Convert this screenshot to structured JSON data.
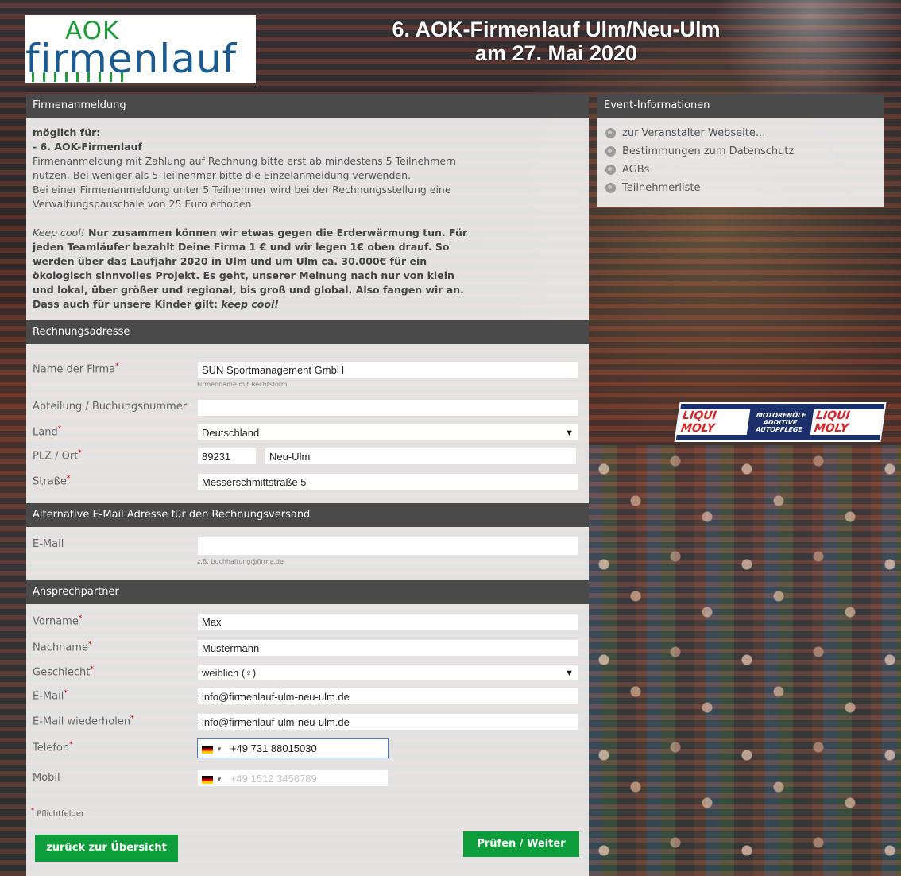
{
  "header": {
    "logo_aok": "AOK",
    "logo_firmenlauf": "firmenlauf",
    "title_line1": "6. AOK-Firmenlauf Ulm/Neu-Ulm",
    "title_line2": "am 27. Mai 2020"
  },
  "background": {
    "banner_left": "LIQUI MOLY",
    "banner_mid": "MOTORENÖLE ADDITIVE AUTOPFLEGE",
    "banner_right": "LIQUI MOLY"
  },
  "firmenanmeldung": {
    "heading": "Firmenanmeldung",
    "possible_for": "möglich für:",
    "event": "- 6. AOK-Firmenlauf",
    "line1": "Firmenanmeldung mit Zahlung auf Rechnung bitte erst ab mindestens 5 Teilnehmern",
    "line2": "nutzen. Bei weniger als 5 Teilnehmer bitte die Einzelanmeldung verwenden.",
    "line3": "Bei einer Firmenanmeldung unter 5 Teilnehmer wird bei der Rechnungsstellung eine",
    "line4": "Verwaltungspauschale von 25 Euro erhoben.",
    "keepcool_italic": "Keep cool!",
    "keepcool_text": " Nur zusammen können wir etwas gegen die Erderwärmung tun. Für jeden Teamläufer bezahlt Deine Firma 1 € und wir legen 1€ oben drauf. So werden über das Laufjahr 2020 in Ulm und um Ulm ca. 30.000€ für ein ökologisch sinnvolles Projekt. Es geht, unserer Meinung nach nur von klein und lokal, über größer und regional, bis groß und global. Also fangen wir an. Dass auch für unsere Kinder gilt: ",
    "keepcool_end": "keep cool!"
  },
  "event_info": {
    "heading": "Event-Informationen",
    "items": [
      {
        "label": "zur Veranstalter Webseite..."
      },
      {
        "label": "Bestimmungen zum Datenschutz"
      },
      {
        "label": "AGBs"
      },
      {
        "label": "Teilnehmerliste"
      }
    ]
  },
  "rechnung": {
    "heading": "Rechnungsadresse",
    "firma_label": "Name der Firma",
    "firma_value": "SUN Sportmanagement GmbH",
    "firma_hint": "Firmenname mit Rechtsform",
    "abteilung_label": "Abteilung / Buchungsnummer",
    "abteilung_value": "",
    "land_label": "Land",
    "land_value": "Deutschland",
    "plz_label": "PLZ / Ort",
    "plz_value": "89231",
    "ort_value": "Neu-Ulm",
    "strasse_label": "Straße",
    "strasse_value": "Messerschmittstraße 5"
  },
  "alt_email": {
    "heading": "Alternative E-Mail Adresse für den Rechnungsversand",
    "label": "E-Mail",
    "value": "",
    "hint": "z.B. buchhaltung@firma.de"
  },
  "ansprechpartner": {
    "heading": "Ansprechpartner",
    "vorname_label": "Vorname",
    "vorname_value": "Max",
    "nachname_label": "Nachname",
    "nachname_value": "Mustermann",
    "geschlecht_label": "Geschlecht",
    "geschlecht_value": "weiblich (♀)",
    "email_label": "E-Mail",
    "email_value": "info@firmenlauf-ulm-neu-ulm.de",
    "email_repeat_label": "E-Mail wiederholen",
    "email_repeat_value": "info@firmenlauf-ulm-neu-ulm.de",
    "telefon_label": "Telefon",
    "telefon_value": "+49 731 88015030",
    "mobil_label": "Mobil",
    "mobil_placeholder": "+49 1512 3456789",
    "required_mark": "*",
    "pflichtfelder": "Pflichtfelder"
  },
  "buttons": {
    "back": "zurück zur Übersicht",
    "next": "Prüfen / Weiter"
  },
  "icons": {
    "select_arrow": "▼",
    "phone_dropdown": "▼"
  }
}
